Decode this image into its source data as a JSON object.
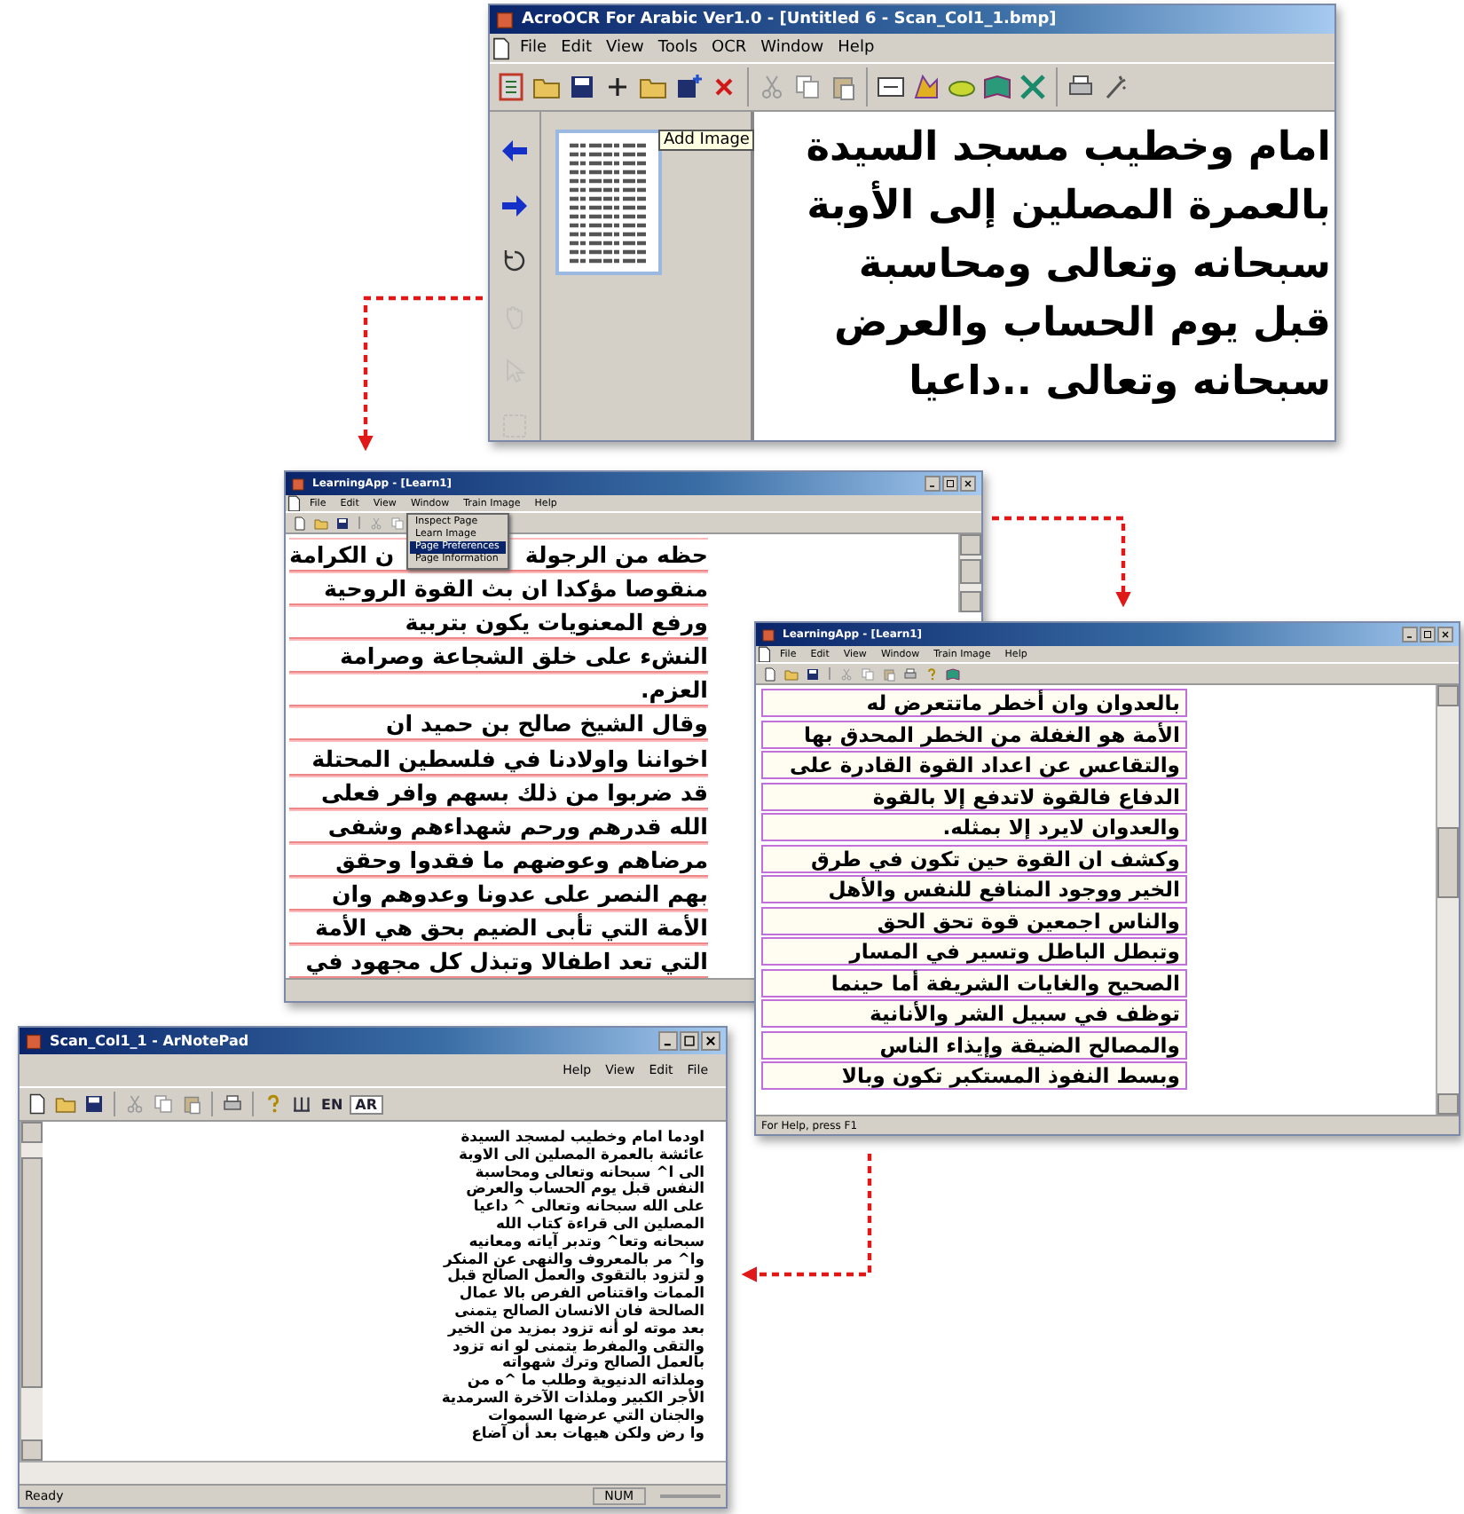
{
  "ocr_window": {
    "title": "AcroOCR For Arabic Ver1.0 - [Untitled 6 - Scan_Col1_1.bmp]",
    "menu": [
      "Help",
      "Window",
      "OCR",
      "Tools",
      "View",
      "Edit",
      "File"
    ],
    "side_tools": [
      {
        "disabled": false
      },
      {
        "disabled": false
      },
      {
        "disabled": false
      },
      {
        "disabled": true
      },
      {
        "disabled": true
      },
      {
        "disabled": true
      }
    ],
    "tooltip": "Add Image",
    "text_lines": [
      "امام وخطيب مسجد السيدة",
      "بالعمرة المصلين إلى الأوبة",
      "سبحانه وتعالى ومحاسبة",
      "قبل يوم الحساب والعرض",
      "سبحانه وتعالى ..داعيا"
    ]
  },
  "learning_window_back": {
    "title": "LearningApp - [Learn1]",
    "menu": [
      "Help",
      "Train Image",
      "Window",
      "View",
      "Edit",
      "File"
    ],
    "dropdown": [
      {
        "label": "Inspect Page",
        "selected": false
      },
      {
        "label": "Learn Image",
        "selected": false
      },
      {
        "label": "Page Preferences",
        "selected": true
      },
      {
        "label": "Page Information",
        "selected": false
      }
    ],
    "first_line_parts": [
      "حظه من الرجولة",
      "ن الكرامة"
    ],
    "text_lines": [
      "منقوصا مؤكدا ان بث القوة الروحية",
      "ورفع المعنويات يكون بتربية",
      "النشء على خلق الشجاعة وصرامة",
      "العزم.",
      "وقال الشيخ صالح بن حميد ان",
      "اخواننا واولادنا في فلسطين المحتلة",
      "قد ضربوا من ذلك بسهم وافر فعلى",
      "الله قدرهم ورحم شهداءهم وشفى",
      "مرضاهم وعوضهم ما فقدوا وحقق",
      "بهم النصر على عدونا وعدوهم وان",
      "الأمة التي تأبى الضيم بحق هي الأمة",
      "التي تعد اطفالا وتبذل كل مجهود في"
    ]
  },
  "learning_window_front": {
    "title": "LearningApp - [Learn1]",
    "menu": [
      "Help",
      "Train Image",
      "Window",
      "View",
      "Edit",
      "File"
    ],
    "text_lines": [
      "بالعدوان وان أخطر ماتتعرض له",
      "الأمة هو الغفلة من الخطر المحدق بها",
      "والتقاعس عن اعداد القوة القادرة على",
      "الدفاع فالقوة لاتدفع إلا بالقوة",
      "والعدوان لايرد إلا بمثله.",
      "وكشف ان القوة حين تكون في طرق",
      "الخير ووجود المنافع للنفس والأهل",
      "والناس اجمعين قوة تحق الحق",
      "وتبطل الباطل وتسير في المسار",
      "الصحيح والغايات الشريفة أما حينما",
      "توظف في سبيل الشر والأنانية",
      "والمصالح الضيقة وإيذاء الناس",
      "وبسط النفوذ المستكبر تكون وبالا"
    ],
    "status_bar": "For Help, press F1"
  },
  "notepad_window": {
    "title": "Scan_Col1_1 - ArNotePad",
    "menu": [
      "File",
      "Edit",
      "View",
      "Help"
    ],
    "toolbar_labels": [
      "AR",
      "EN"
    ],
    "text_lines": [
      "اودما امام وخطيب لمسجد السيدة",
      "عائشة بالعمرة المصلين الى الاوبة",
      "الى ا^ سبحانه وتعالى ومحاسبة",
      "النفس قبل يوم الحساب والعرض",
      "على الله سبحانه وتعالى ^ داعيا",
      "المصلين الى قراءة كتاب الله",
      "سبحانه وتعا^ وتدبر آياته ومعانيه",
      "وا^ مر بالمعروف والنهى عن المنكر",
      "و لتزود بالتقوى والعمل الصالح قبل",
      "الممات واقتناص الفرص بالا عمال",
      "الصالحة فان الانسان الصالح يتمنى",
      "بعد موته لو أنه تزود بمزيد من الخير",
      "والتقى والمفرط يتمنى لو انه تزود",
      "بالعمل الصالح وترك شهواته",
      "وملذاته الدنيوية وطلب ما ^ه من",
      "الأجر الكبير وملذات الآخرة السرمدية",
      "والجنان التي عرضها السموات",
      "وا رض ولكن هيهات بعد أن آضاع"
    ],
    "status_bar": {
      "message": "Ready",
      "indicators": [
        "NUM"
      ]
    }
  }
}
